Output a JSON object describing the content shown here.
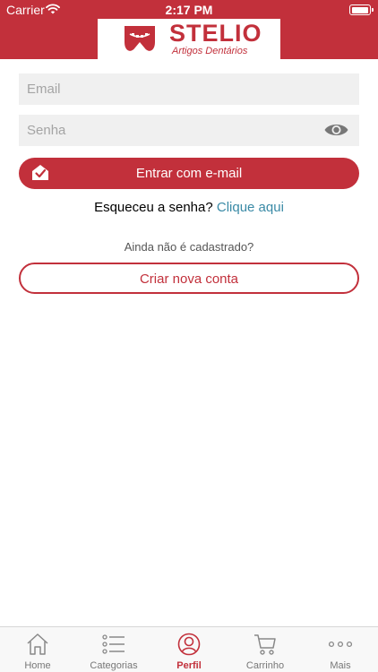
{
  "status_bar": {
    "carrier": "Carrier",
    "time": "2:17 PM",
    "battery_level": 0.95
  },
  "brand": {
    "name": "STELIO",
    "subtitle": "Artigos Dentários"
  },
  "colors": {
    "primary": "#c2303b",
    "link": "#3a8aa6",
    "field_bg": "#f0f0f0"
  },
  "form": {
    "email_placeholder": "Email",
    "password_placeholder": "Senha",
    "login_label": "Entrar com e-mail",
    "forgot_question": "Esqueceu a senha?",
    "forgot_link": "Clique aqui",
    "not_registered": "Ainda não é cadastrado?",
    "create_account_label": "Criar nova conta"
  },
  "tabs": [
    {
      "label": "Home",
      "icon": "home-icon",
      "active": false
    },
    {
      "label": "Categorias",
      "icon": "list-icon",
      "active": false
    },
    {
      "label": "Perfil",
      "icon": "profile-icon",
      "active": true
    },
    {
      "label": "Carrinho",
      "icon": "cart-icon",
      "active": false
    },
    {
      "label": "Mais",
      "icon": "more-icon",
      "active": false
    }
  ]
}
